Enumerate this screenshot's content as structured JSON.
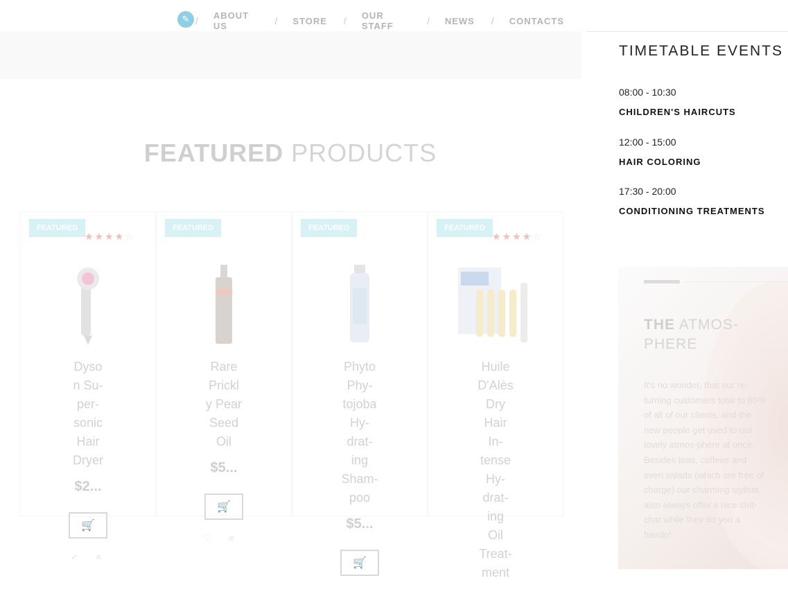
{
  "nav": {
    "edit_icon": "pencil-icon",
    "items": [
      "ABOUT US",
      "STORE",
      "OUR STAFF",
      "NEWS",
      "CONTACTS"
    ],
    "separator": "/"
  },
  "featured": {
    "title_bold": "FEATURED",
    "title_light": "PRODUCTS"
  },
  "products": [
    {
      "badge": "FEATURED",
      "name_lines": [
        "Dyso",
        "n Su-",
        "per-",
        "sonic",
        "Hair",
        "Dryer"
      ],
      "price": "$2...",
      "rating": 4,
      "rating_max": 5
    },
    {
      "badge": "FEATURED",
      "name_lines": [
        "Rare",
        "Prickl",
        "y Pear",
        "Seed",
        "Oil"
      ],
      "price": "$5...",
      "rating": null,
      "rating_max": 5
    },
    {
      "badge": "FEATURED",
      "name_lines": [
        "Phyto",
        "Phy-",
        "tojoba",
        "Hy-",
        "drat-",
        "ing",
        "Sham-",
        "poo"
      ],
      "price": "$5...",
      "rating": null,
      "rating_max": 5
    },
    {
      "badge": "FEATURED",
      "name_lines": [
        "Huile",
        "D'Alès",
        "Dry",
        "Hair",
        "In-",
        "tense",
        "Hy-",
        "drat-",
        "ing",
        "Oil",
        "Treat-",
        "ment"
      ],
      "price": "",
      "rating": 4,
      "rating_max": 5
    }
  ],
  "icons": {
    "cart": "cart-icon",
    "wishlist": "heart-icon",
    "compare": "list-icon",
    "check": "check-icon",
    "star": "star-icon"
  },
  "sidebar": {
    "title": "TIMETABLE EVENTS",
    "events": [
      {
        "time": "08:00 - 10:30",
        "name": "CHILDREN'S HAIRCUTS"
      },
      {
        "time": "12:00 - 15:00",
        "name": "HAIR COLORING"
      },
      {
        "time": "17:30 - 20:00",
        "name": "CONDITIONING TREATMENTS"
      }
    ]
  },
  "atmosphere": {
    "title_bold": "THE",
    "title_light_1": "ATMOS-",
    "title_light_2": "PHERE",
    "text": "It's no wonder, that our re-turning customers total to 85% of all of our clients, and the new people get used to our lovely atmos-phere at once. Besides teas, coffees and even salads (which are free of charge) our charming stylists also always offer a nice chit-chat while they do you a hairdo!"
  },
  "colors": {
    "accent": "#8cd0e8",
    "badge": "#d6f2f4",
    "star": "#f6c0b0"
  }
}
